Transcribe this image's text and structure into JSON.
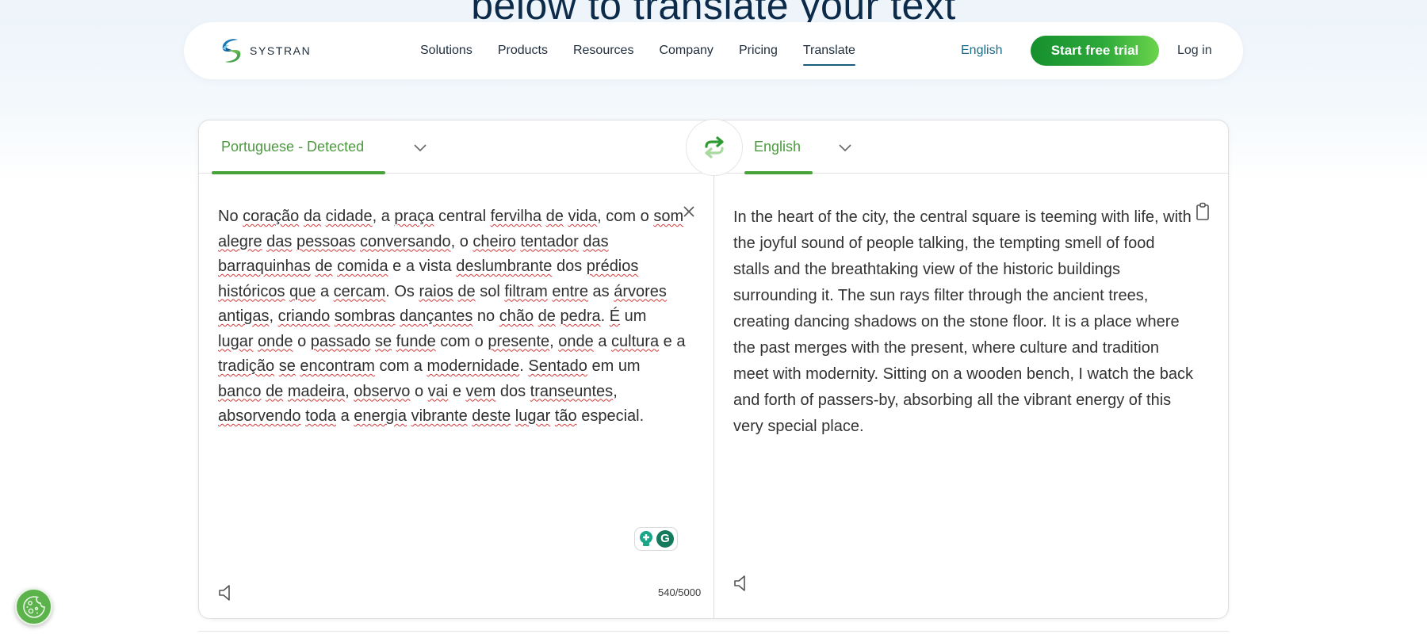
{
  "hero": {
    "heading": "below to translate your text"
  },
  "nav": {
    "brand": "SYSTRAN",
    "links": [
      {
        "label": "Solutions"
      },
      {
        "label": "Products"
      },
      {
        "label": "Resources"
      },
      {
        "label": "Company"
      },
      {
        "label": "Pricing"
      },
      {
        "label": "Translate",
        "active": true
      }
    ],
    "language": "English",
    "cta": "Start free trial",
    "login": "Log in"
  },
  "translator": {
    "source_lang": "Portuguese - Detected",
    "target_lang": "English",
    "source_words": [
      [
        "No",
        false
      ],
      [
        "coração",
        true
      ],
      [
        "da",
        true
      ],
      [
        "cidade",
        true
      ],
      [
        ", a",
        false
      ],
      [
        "praça",
        true
      ],
      [
        "central",
        false
      ],
      [
        "fervilha",
        true
      ],
      [
        "de",
        true
      ],
      [
        "vida",
        true
      ],
      [
        ",",
        false
      ],
      [
        "com o",
        false
      ],
      [
        "som",
        true
      ],
      [
        "alegre",
        true
      ],
      [
        "das",
        true
      ],
      [
        "pessoas",
        true
      ],
      [
        "conversando",
        true
      ],
      [
        ", o",
        false
      ],
      [
        "cheiro",
        true
      ],
      [
        "tentador",
        true
      ],
      [
        "das",
        true
      ],
      [
        "barraquinhas",
        true
      ],
      [
        "de",
        true
      ],
      [
        "comida",
        true
      ],
      [
        "e a vista",
        false
      ],
      [
        "deslumbrante",
        true
      ],
      [
        "dos",
        false
      ],
      [
        "prédios",
        true
      ],
      [
        "históricos",
        true
      ],
      [
        "que",
        true
      ],
      [
        "a",
        false
      ],
      [
        "cercam",
        true
      ],
      [
        ". Os",
        false
      ],
      [
        "raios",
        true
      ],
      [
        "de",
        true
      ],
      [
        "sol",
        false
      ],
      [
        "filtram",
        true
      ],
      [
        "entre",
        true
      ],
      [
        "as",
        false
      ],
      [
        "árvores",
        true
      ],
      [
        "antigas",
        true
      ],
      [
        ",",
        false
      ],
      [
        "criando",
        true
      ],
      [
        "sombras",
        true
      ],
      [
        "dançantes",
        true
      ],
      [
        "no",
        false
      ],
      [
        "chão",
        true
      ],
      [
        "de",
        true
      ],
      [
        "pedra",
        true
      ],
      [
        ".",
        false
      ],
      [
        "É",
        true
      ],
      [
        "um",
        false
      ],
      [
        "lugar",
        true
      ],
      [
        "onde",
        true
      ],
      [
        "o",
        false
      ],
      [
        "passado",
        true
      ],
      [
        "se",
        true
      ],
      [
        "funde",
        true
      ],
      [
        "com o",
        false
      ],
      [
        "presente",
        true
      ],
      [
        ",",
        false
      ],
      [
        "onde",
        true
      ],
      [
        "a",
        false
      ],
      [
        "cultura",
        true
      ],
      [
        "e a",
        false
      ],
      [
        "tradição",
        true
      ],
      [
        "se",
        true
      ],
      [
        "encontram",
        true
      ],
      [
        "com a",
        false
      ],
      [
        "modernidade",
        true
      ],
      [
        ".",
        false
      ],
      [
        "Sentado",
        true
      ],
      [
        "em",
        false
      ],
      [
        "um",
        false
      ],
      [
        "banco",
        true
      ],
      [
        "de",
        true
      ],
      [
        "madeira",
        true
      ],
      [
        ",",
        false
      ],
      [
        "observo",
        true
      ],
      [
        "o",
        false
      ],
      [
        "vai",
        true
      ],
      [
        "e",
        false
      ],
      [
        "vem",
        true
      ],
      [
        "dos",
        false
      ],
      [
        "transeuntes",
        true
      ],
      [
        ",",
        false
      ],
      [
        "absorvendo",
        true
      ],
      [
        "toda",
        true
      ],
      [
        "a",
        false
      ],
      [
        "energia",
        true
      ],
      [
        "vibrante",
        true
      ],
      [
        "deste",
        true
      ],
      [
        "lugar",
        true
      ],
      [
        "tão",
        true
      ],
      [
        "especial.",
        false
      ]
    ],
    "source_text": "No coração da cidade, a praça central fervilha de vida, com o som alegre das pessoas conversando, o cheiro tentador das barraquinhas de comida e a vista deslumbrante dos prédios históricos que a cercam. Os raios de sol filtram entre as árvores antigas, criando sombras dançantes no chão de pedra. É um lugar onde o passado se funde com o presente, onde a cultura e a tradição se encontram com a modernidade. Sentado em um banco de madeira, observo o vai e vem dos transeuntes, absorvendo toda a energia vibrante deste lugar tão especial.",
    "target_text": "In the heart of the city, the central square is teeming with life, with the joyful sound of people talking, the tempting smell of food stalls and the breathtaking view of the historic buildings surrounding it. The sun rays filter through the ancient trees, creating dancing shadows on the stone floor. It is a place where the past merges with the present, where culture and tradition meet with modernity. Sitting on a wooden bench, I watch the back and forth of passers-by, absorbing all the vibrant energy of this very special place.",
    "char_count": "540/5000",
    "icons": {
      "swap": "swap-arrows-icon",
      "clear": "close-icon",
      "copy": "clipboard-icon",
      "speak_source": "speaker-icon",
      "speak_target": "speaker-icon",
      "grammarly": "grammarly-icon",
      "cookie": "cookie-icon"
    }
  },
  "colors": {
    "accent_green": "#47a23a",
    "nav_text": "#1f2d3d",
    "heading_navy": "#0c2a4a"
  }
}
